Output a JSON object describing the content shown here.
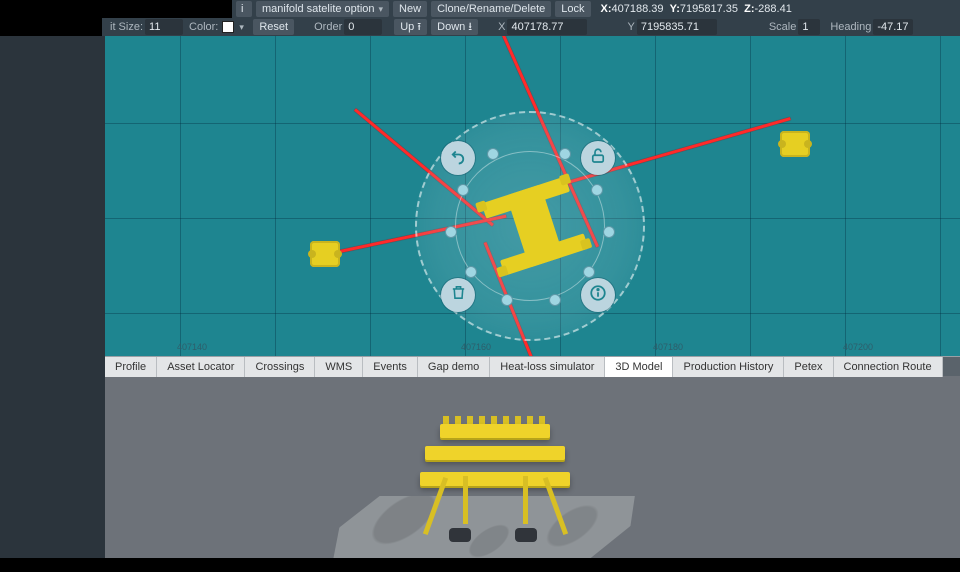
{
  "toolbar1": {
    "info_label": "i",
    "select_value": "manifold satelite option",
    "new_label": "New",
    "clone_label": "Clone/Rename/Delete",
    "lock_label": "Lock",
    "coord_x_key": "X:",
    "coord_x": "407188.39",
    "coord_y_key": "Y:",
    "coord_y": "7195817.35",
    "coord_z_key": "Z:",
    "coord_z": "-288.41"
  },
  "toolbar2": {
    "size_label": "it Size:",
    "size_value": "11",
    "color_label": "Color:",
    "reset_label": "Reset",
    "order_label": "Order",
    "order_value": "0",
    "up_label": "Up",
    "down_label": "Down",
    "x_label": "X",
    "x_value": "407178.77",
    "y_label": "Y",
    "y_value": "7195835.71",
    "scale_label": "Scale",
    "scale_value": "1",
    "heading_label": "Heading",
    "heading_value": "-47.17"
  },
  "map": {
    "grid_labels": [
      "407140",
      "407160",
      "407180",
      "407200"
    ],
    "actions": {
      "undo": "undo-icon",
      "unlock": "unlock-icon",
      "delete": "trash-icon",
      "info": "info-icon"
    }
  },
  "tabs": {
    "items": [
      "Profile",
      "Asset Locator",
      "Crossings",
      "WMS",
      "Events",
      "Gap demo",
      "Heat-loss simulator",
      "3D Model",
      "Production History",
      "Petex",
      "Connection Route"
    ],
    "active": "3D Model"
  }
}
